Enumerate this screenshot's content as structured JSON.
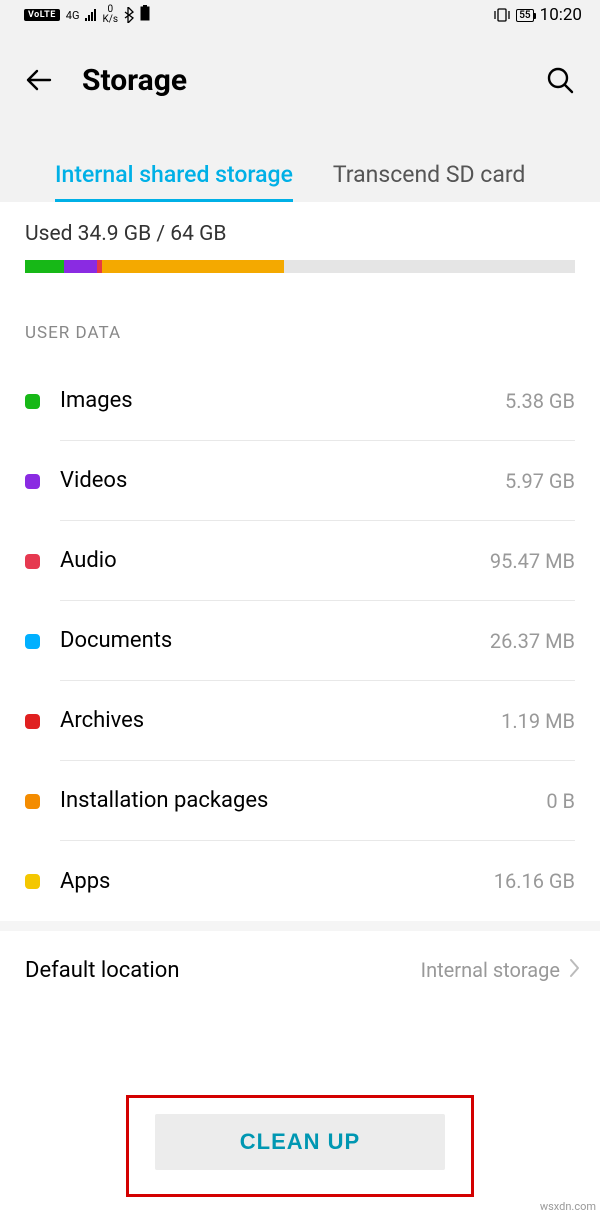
{
  "status_bar": {
    "volte": "VoLTE",
    "net_type": "4G",
    "speed_value": "0",
    "speed_unit": "K/s",
    "battery_pct": "55",
    "time": "10:20"
  },
  "header": {
    "title": "Storage"
  },
  "tabs": {
    "active": "Internal shared storage",
    "second": "Transcend SD card"
  },
  "usage": {
    "text": "Used 34.9 GB / 64 GB",
    "segments": [
      {
        "color": "#17b817",
        "width": 7
      },
      {
        "color": "#8a2be2",
        "width": 6
      },
      {
        "color": "#e63946",
        "width": 1
      },
      {
        "color": "#f4a900",
        "width": 33
      }
    ]
  },
  "section_label": "USER DATA",
  "rows": [
    {
      "name": "images",
      "label": "Images",
      "size": "5.38 GB",
      "color": "#17b817"
    },
    {
      "name": "videos",
      "label": "Videos",
      "size": "5.97 GB",
      "color": "#8a2be2"
    },
    {
      "name": "audio",
      "label": "Audio",
      "size": "95.47 MB",
      "color": "#e63950"
    },
    {
      "name": "documents",
      "label": "Documents",
      "size": "26.37 MB",
      "color": "#00b0ff"
    },
    {
      "name": "archives",
      "label": "Archives",
      "size": "1.19 MB",
      "color": "#e02020"
    },
    {
      "name": "installation-packages",
      "label": "Installation packages",
      "size": "0 B",
      "color": "#f48c00"
    },
    {
      "name": "apps",
      "label": "Apps",
      "size": "16.16 GB",
      "color": "#f4c700"
    }
  ],
  "default_location": {
    "label": "Default location",
    "value": "Internal storage"
  },
  "cleanup": {
    "label": "CLEAN UP"
  },
  "watermark": "wsxdn.com"
}
